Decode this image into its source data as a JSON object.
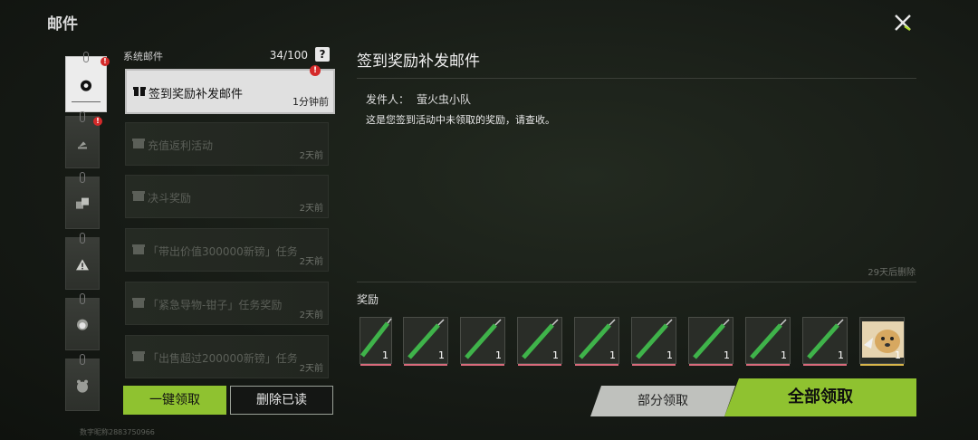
{
  "header": {
    "title": "邮件"
  },
  "list": {
    "section_label": "系统邮件",
    "count": "34/100",
    "help_glyph": "?",
    "items": [
      {
        "subject": "签到奖励补发邮件",
        "time": "1分钟前"
      },
      {
        "subject": "充值返利活动",
        "time": "2天前"
      },
      {
        "subject": "决斗奖励",
        "time": "2天前"
      },
      {
        "subject": "「带出价值300000新镑」任务",
        "time": "2天前"
      },
      {
        "subject": "「紧急导物-钳子」任务奖励",
        "time": "2天前"
      },
      {
        "subject": "「出售超过200000新镑」任务",
        "time": "2天前"
      }
    ],
    "claim_all_label": "一键领取",
    "delete_read_label": "删除已读"
  },
  "user_id": "数字昵称2883750966",
  "detail": {
    "title": "签到奖励补发邮件",
    "sender_label": "发件人：",
    "sender": "萤火虫小队",
    "body": "这是您签到活动中未领取的奖励，请查收。",
    "expire": "29天后删除",
    "rewards_label": "奖励",
    "rewards": [
      {
        "qty": "1",
        "kind": "syringe"
      },
      {
        "qty": "1",
        "kind": "syringe"
      },
      {
        "qty": "1",
        "kind": "syringe"
      },
      {
        "qty": "1",
        "kind": "syringe"
      },
      {
        "qty": "1",
        "kind": "syringe"
      },
      {
        "qty": "1",
        "kind": "syringe"
      },
      {
        "qty": "1",
        "kind": "syringe"
      },
      {
        "qty": "1",
        "kind": "syringe"
      },
      {
        "qty": "1",
        "kind": "syringe"
      },
      {
        "qty": "1",
        "kind": "dog-card"
      }
    ],
    "partial_claim_label": "部分领取",
    "claim_all_label": "全部领取"
  },
  "colors": {
    "accent": "#8fc230",
    "alert": "#d42a2a"
  }
}
